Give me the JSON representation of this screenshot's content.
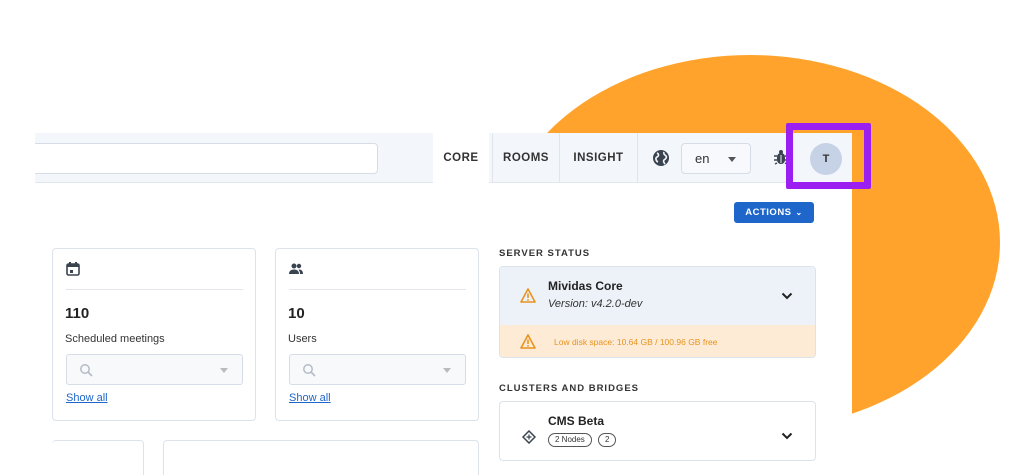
{
  "nav": {
    "items": [
      "CORE",
      "ROOMS",
      "INSIGHT"
    ],
    "language": "en",
    "avatar_initial": "T"
  },
  "toolbar": {
    "actions_label": "ACTIONS"
  },
  "cards": [
    {
      "count": "110",
      "label": "Scheduled meetings",
      "link": "Show all"
    },
    {
      "count": "10",
      "label": "Users",
      "link": "Show all"
    }
  ],
  "server_status": {
    "title": "SERVER STATUS",
    "name": "Mividas Core",
    "version": "Version: v4.2.0-dev",
    "alert": "Low disk space: 10.64 GB / 100.96 GB free"
  },
  "clusters": {
    "title": "CLUSTERS AND BRIDGES",
    "name": "CMS Beta",
    "pill_1": "2 Nodes",
    "pill_2": "2"
  },
  "colors": {
    "accent": "#1e66c9",
    "highlight": "#9a1ff0",
    "blob": "#ffa32d",
    "warning": "#e89320"
  },
  "icons": [
    "globe-icon",
    "bug-icon",
    "calendar-icon",
    "users-icon",
    "search-icon",
    "warning-icon",
    "chevron-down-icon",
    "cluster-icon"
  ]
}
